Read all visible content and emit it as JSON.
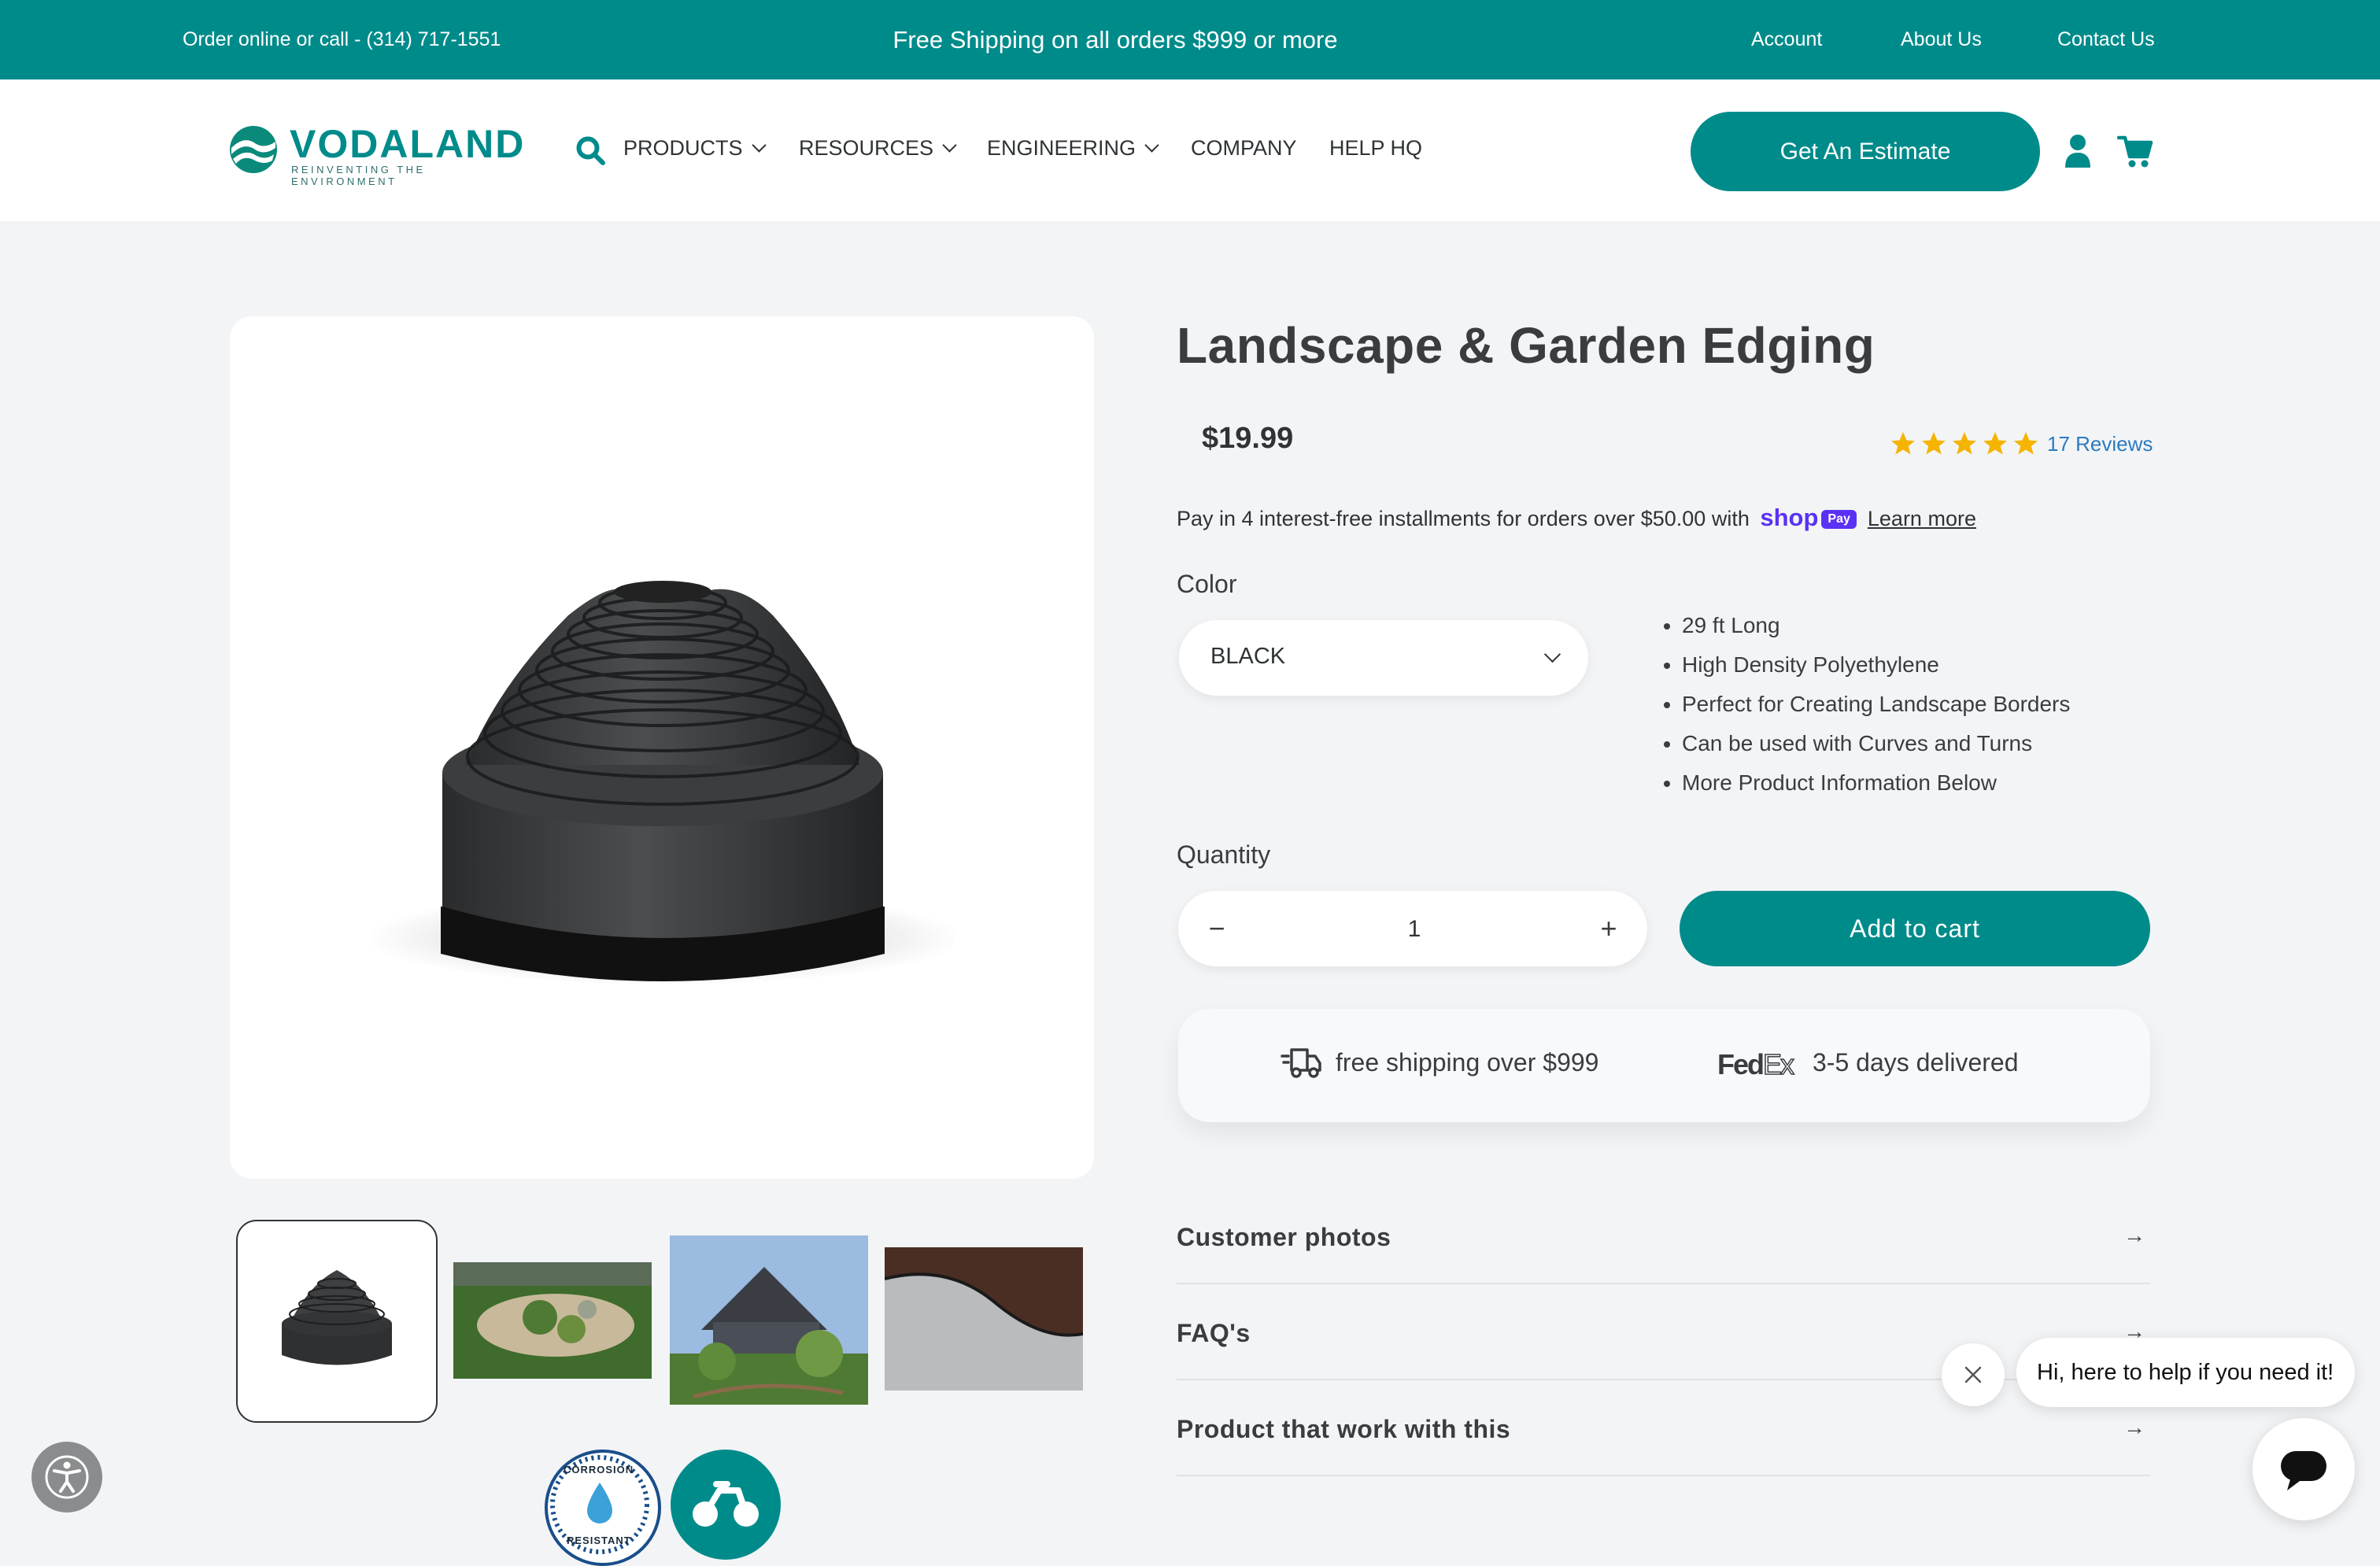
{
  "topbar": {
    "order_text": "Order online or call - (314) 717-1551",
    "promo": "Free Shipping on all orders $999 or more",
    "links": [
      "Account",
      "About Us",
      "Contact Us"
    ]
  },
  "header": {
    "logo_word": "VODALAND",
    "logo_tagline": "REINVENTING THE ENVIRONMENT",
    "search_icon": "search-icon",
    "nav": [
      {
        "label": "PRODUCTS",
        "dropdown": true
      },
      {
        "label": "RESOURCES",
        "dropdown": true
      },
      {
        "label": "ENGINEERING",
        "dropdown": true
      },
      {
        "label": "COMPANY",
        "dropdown": false
      },
      {
        "label": "HELP HQ",
        "dropdown": false
      }
    ],
    "cta": "Get An Estimate",
    "account_icon": "user-icon",
    "cart_icon": "cart-icon"
  },
  "product": {
    "title": "Landscape & Garden Edging",
    "price": "$19.99",
    "rating": 5,
    "reviews_label": "17 Reviews",
    "installments": {
      "text": "Pay in 4 interest-free installments for orders over $50.00 with",
      "shop": "shop",
      "pay_badge": "Pay",
      "learn_more": "Learn more"
    },
    "color_label": "Color",
    "color_value": "BLACK",
    "features": [
      "29 ft Long",
      "High Density Polyethylene",
      "Perfect for Creating Landscape Borders",
      "Can be used with Curves and Turns",
      "More Product Information Below"
    ],
    "quantity_label": "Quantity",
    "quantity": "1",
    "minus": "−",
    "plus": "+",
    "add_to_cart": "Add to cart",
    "shipping": {
      "free": "free shipping over $999",
      "carrier_main": "Fed",
      "carrier_ex": "Ex",
      "delivery": "3-5 days delivered"
    },
    "accordions": [
      "Customer photos",
      "FAQ's",
      "Product that work with this"
    ],
    "accordion_arrow": "→"
  },
  "gallery": {
    "thumbnails": [
      "product",
      "garden-bed",
      "house-garden",
      "gravel-path"
    ],
    "badges": [
      {
        "icon": "corrosion-resistant-badge-icon",
        "text_top": "CORROSION",
        "text_bottom": "RESISTANT"
      },
      {
        "icon": "bike-badge-icon"
      }
    ]
  },
  "chat": {
    "message": "Hi, here to help if you need it!"
  },
  "colors": {
    "brand": "#008b8b",
    "shop_pay": "#5a31f4",
    "star": "#f5b400",
    "link": "#2b7bc1"
  }
}
